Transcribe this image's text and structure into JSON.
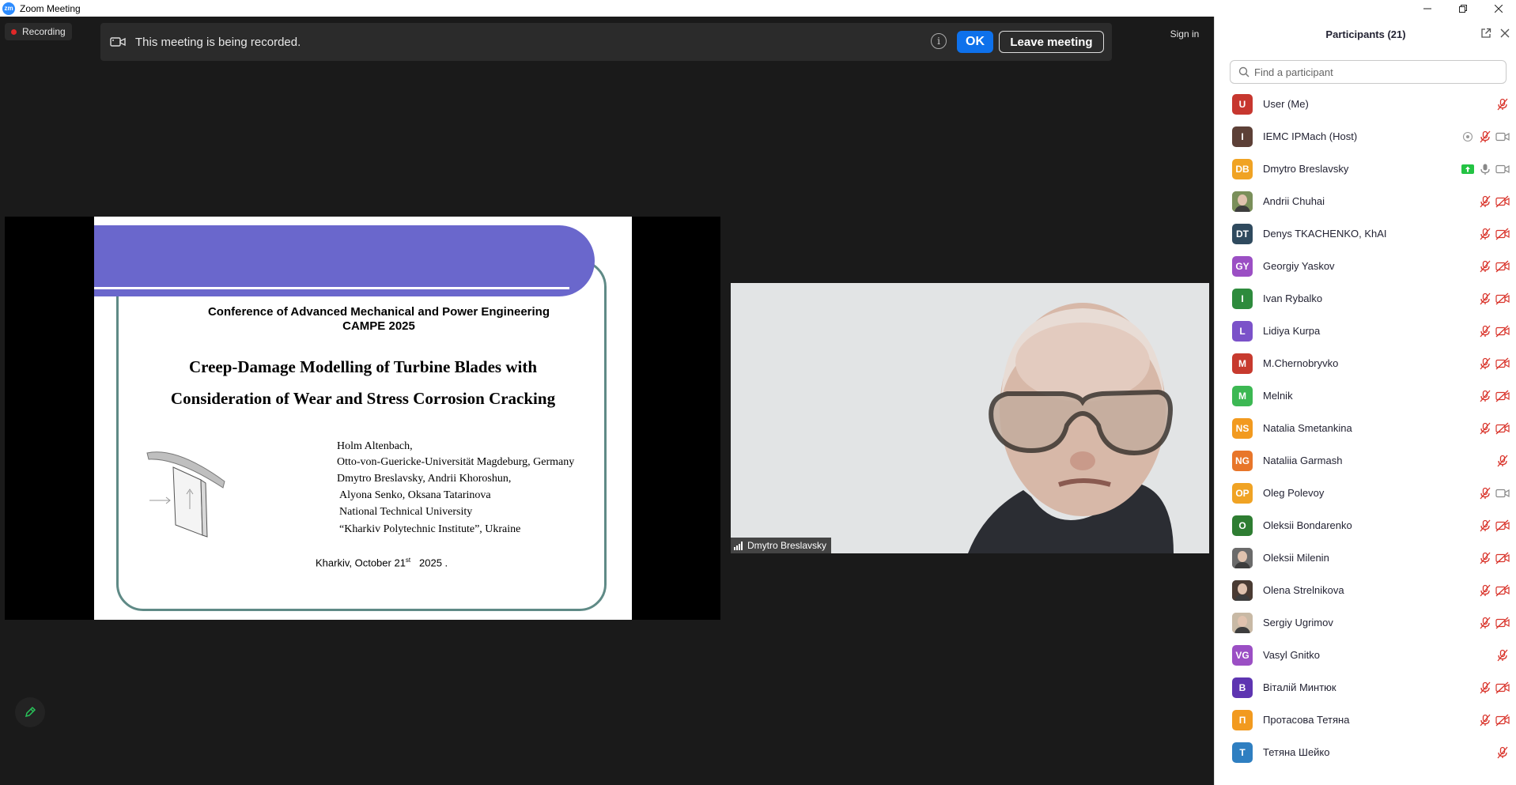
{
  "window": {
    "title": "Zoom Meeting",
    "logo": "zm"
  },
  "recording": {
    "label": "Recording"
  },
  "banner": {
    "message": "This meeting is being recorded.",
    "ok": "OK",
    "leave": "Leave meeting",
    "info": "i"
  },
  "signin": "Sign in",
  "slide": {
    "conf_line1": "Conference of Advanced Mechanical and Power Engineering",
    "conf_line2": "CAMPE 2025",
    "title_line1": "Creep-Damage Modelling of Turbine Blades with",
    "title_line2": "Consideration of Wear and Stress Corrosion Cracking",
    "authors": [
      "Holm Altenbach,",
      "Otto-von-Guericke-Universität Magdeburg, Germany",
      "Dmytro Breslavsky, Andrii Khoroshun,",
      "Alyona Senko, Oksana Tatarinova",
      "National Technical University",
      "“Kharkiv Polytechnic Institute”, Ukraine"
    ],
    "date_city": "Kharkiv, October 21",
    "date_sup": "st",
    "date_year": "2025 ."
  },
  "video": {
    "name": "Dmytro Breslavsky"
  },
  "participants": {
    "title": "Participants (21)",
    "search_placeholder": "Find a participant",
    "list": [
      {
        "name": "User (Me)",
        "initials": "U",
        "color": "#c7372f",
        "icons": [
          "mic-muted"
        ]
      },
      {
        "name": "IEMC IPMach (Host)",
        "initials": "I",
        "color": "#5d4037",
        "icons": [
          "record",
          "mic-muted",
          "video"
        ]
      },
      {
        "name": "Dmytro Breslavsky",
        "initials": "DB",
        "color": "#f0a324",
        "icons": [
          "share",
          "mic",
          "video"
        ]
      },
      {
        "name": "Andrii Chuhai",
        "initials": "",
        "color": "#7a8f5a",
        "photo": true,
        "icons": [
          "mic-muted",
          "video-off"
        ]
      },
      {
        "name": "Denys TKACHENKO, KhAI",
        "initials": "DT",
        "color": "#2f4a5e",
        "icons": [
          "mic-muted",
          "video-off"
        ]
      },
      {
        "name": "Georgiy Yaskov",
        "initials": "GY",
        "color": "#9b4fc4",
        "icons": [
          "mic-muted",
          "video-off"
        ]
      },
      {
        "name": "Ivan Rybalko",
        "initials": "I",
        "color": "#2e8b3d",
        "icons": [
          "mic-muted",
          "video-off"
        ]
      },
      {
        "name": "Lidiya Kurpa",
        "initials": "L",
        "color": "#7b52c9",
        "icons": [
          "mic-muted",
          "video-off"
        ]
      },
      {
        "name": "M.Chernobryvko",
        "initials": "M",
        "color": "#c73a2e",
        "icons": [
          "mic-muted",
          "video-off"
        ]
      },
      {
        "name": "Melnik",
        "initials": "M",
        "color": "#3cb853",
        "icons": [
          "mic-muted",
          "video-off"
        ]
      },
      {
        "name": "Natalia Smetankina",
        "initials": "NS",
        "color": "#f29a1f",
        "icons": [
          "mic-muted",
          "video-off"
        ]
      },
      {
        "name": "Nataliia Garmash",
        "initials": "NG",
        "color": "#e8762a",
        "icons": [
          "mic-muted"
        ]
      },
      {
        "name": "Oleg Polevoy",
        "initials": "OP",
        "color": "#f0a324",
        "icons": [
          "mic-muted",
          "video"
        ]
      },
      {
        "name": "Oleksii Bondarenko",
        "initials": "O",
        "color": "#2e7d32",
        "icons": [
          "mic-muted",
          "video-off"
        ]
      },
      {
        "name": "Oleksii Milenin",
        "initials": "",
        "color": "#6b6b6b",
        "photo": true,
        "icons": [
          "mic-muted",
          "video-off"
        ]
      },
      {
        "name": "Olena Strelnikova",
        "initials": "",
        "color": "#4a3b33",
        "photo": true,
        "icons": [
          "mic-muted",
          "video-off"
        ]
      },
      {
        "name": "Sergiy Ugrimov",
        "initials": "",
        "color": "#c8b9a5",
        "photo": true,
        "icons": [
          "mic-muted",
          "video-off"
        ]
      },
      {
        "name": "Vasyl Gnitko",
        "initials": "VG",
        "color": "#9b4fc4",
        "icons": [
          "mic-muted"
        ]
      },
      {
        "name": "Віталій Минтюк",
        "initials": "В",
        "color": "#5e35b1",
        "icons": [
          "mic-muted",
          "video-off"
        ]
      },
      {
        "name": "Протасова Тетяна",
        "initials": "П",
        "color": "#f29a1f",
        "icons": [
          "mic-muted",
          "video-off"
        ]
      },
      {
        "name": "Тетяна Шейко",
        "initials": "Т",
        "color": "#2f7fc1",
        "icons": [
          "mic-muted"
        ]
      }
    ]
  }
}
